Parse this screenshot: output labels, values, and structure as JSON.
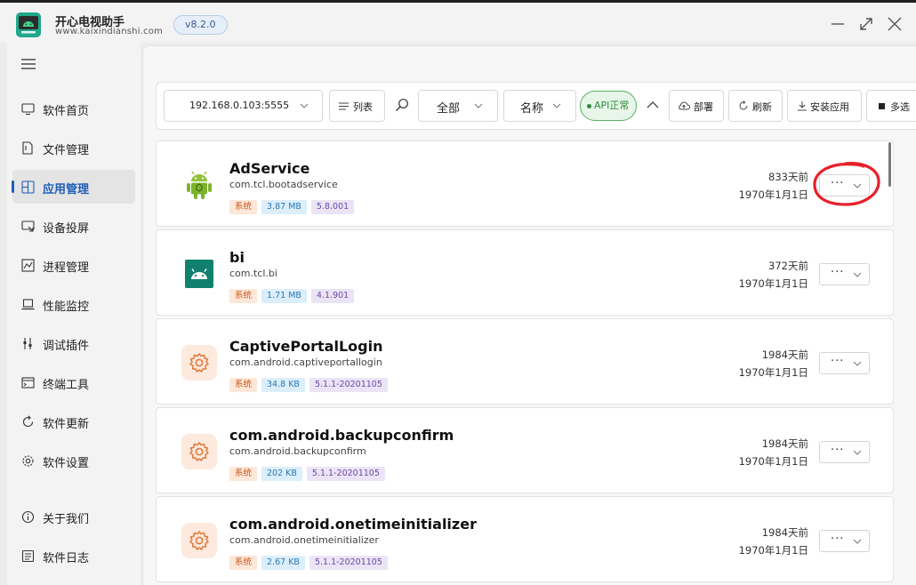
{
  "window": {
    "app_name": "开心电视助手",
    "app_url": "www.kaixindianshi.com",
    "version": "v8.2.0"
  },
  "sidebar": {
    "items": [
      {
        "label": "软件首页",
        "icon": "monitor-icon"
      },
      {
        "label": "文件管理",
        "icon": "folder-icon"
      },
      {
        "label": "应用管理",
        "icon": "apps-icon",
        "active": true
      },
      {
        "label": "设备投屏",
        "icon": "cast-icon"
      },
      {
        "label": "进程管理",
        "icon": "chart-icon"
      },
      {
        "label": "性能监控",
        "icon": "laptop-icon"
      },
      {
        "label": "调试插件",
        "icon": "plug-icon"
      },
      {
        "label": "终端工具",
        "icon": "terminal-icon"
      },
      {
        "label": "软件更新",
        "icon": "refresh-icon"
      },
      {
        "label": "软件设置",
        "icon": "gear-icon"
      },
      {
        "label": "关于我们",
        "icon": "info-icon"
      },
      {
        "label": "软件日志",
        "icon": "log-icon"
      }
    ]
  },
  "toolbar": {
    "device": "192.168.0.103:5555",
    "view_label": "列表",
    "filter_all": "全部",
    "sort_name": "名称",
    "api_status": "API正常",
    "deploy_label": "部署",
    "refresh_label": "刷新",
    "install_label": "安装应用",
    "multiselect_label": "多选"
  },
  "apps": [
    {
      "title": "AdService",
      "package": "com.tcl.bootadservice",
      "tag_system": "系统",
      "size": "3.87 MB",
      "version": "5.8.001",
      "days": "833天前",
      "date": "1970年1月1日",
      "icon": "android-robot-icon"
    },
    {
      "title": "bi",
      "package": "com.tcl.bi",
      "tag_system": "系统",
      "size": "1.71 MB",
      "version": "4.1.901",
      "days": "372天前",
      "date": "1970年1月1日",
      "icon": "android-teal-icon"
    },
    {
      "title": "CaptivePortalLogin",
      "package": "com.android.captiveportallogin",
      "tag_system": "系统",
      "size": "34.8 KB",
      "version": "5.1.1-20201105",
      "days": "1984天前",
      "date": "1970年1月1日",
      "icon": "gear-icon"
    },
    {
      "title": "com.android.backupconfirm",
      "package": "com.android.backupconfirm",
      "tag_system": "系统",
      "size": "202 KB",
      "version": "5.1.1-20201105",
      "days": "1984天前",
      "date": "1970年1月1日",
      "icon": "gear-icon"
    },
    {
      "title": "com.android.onetimeinitializer",
      "package": "com.android.onetimeinitializer",
      "tag_system": "系统",
      "size": "2.67 KB",
      "version": "5.1.1-20201105",
      "days": "1984天前",
      "date": "1970年1月1日",
      "icon": "gear-icon"
    }
  ],
  "more_button": "···",
  "colors": {
    "accent": "#1f5fb8",
    "api_ok": "#2e8a3b",
    "tag_system": "#c6581c",
    "tag_size": "#2a79b5",
    "tag_version": "#6b4aa3",
    "annotation": "#e8202a"
  }
}
